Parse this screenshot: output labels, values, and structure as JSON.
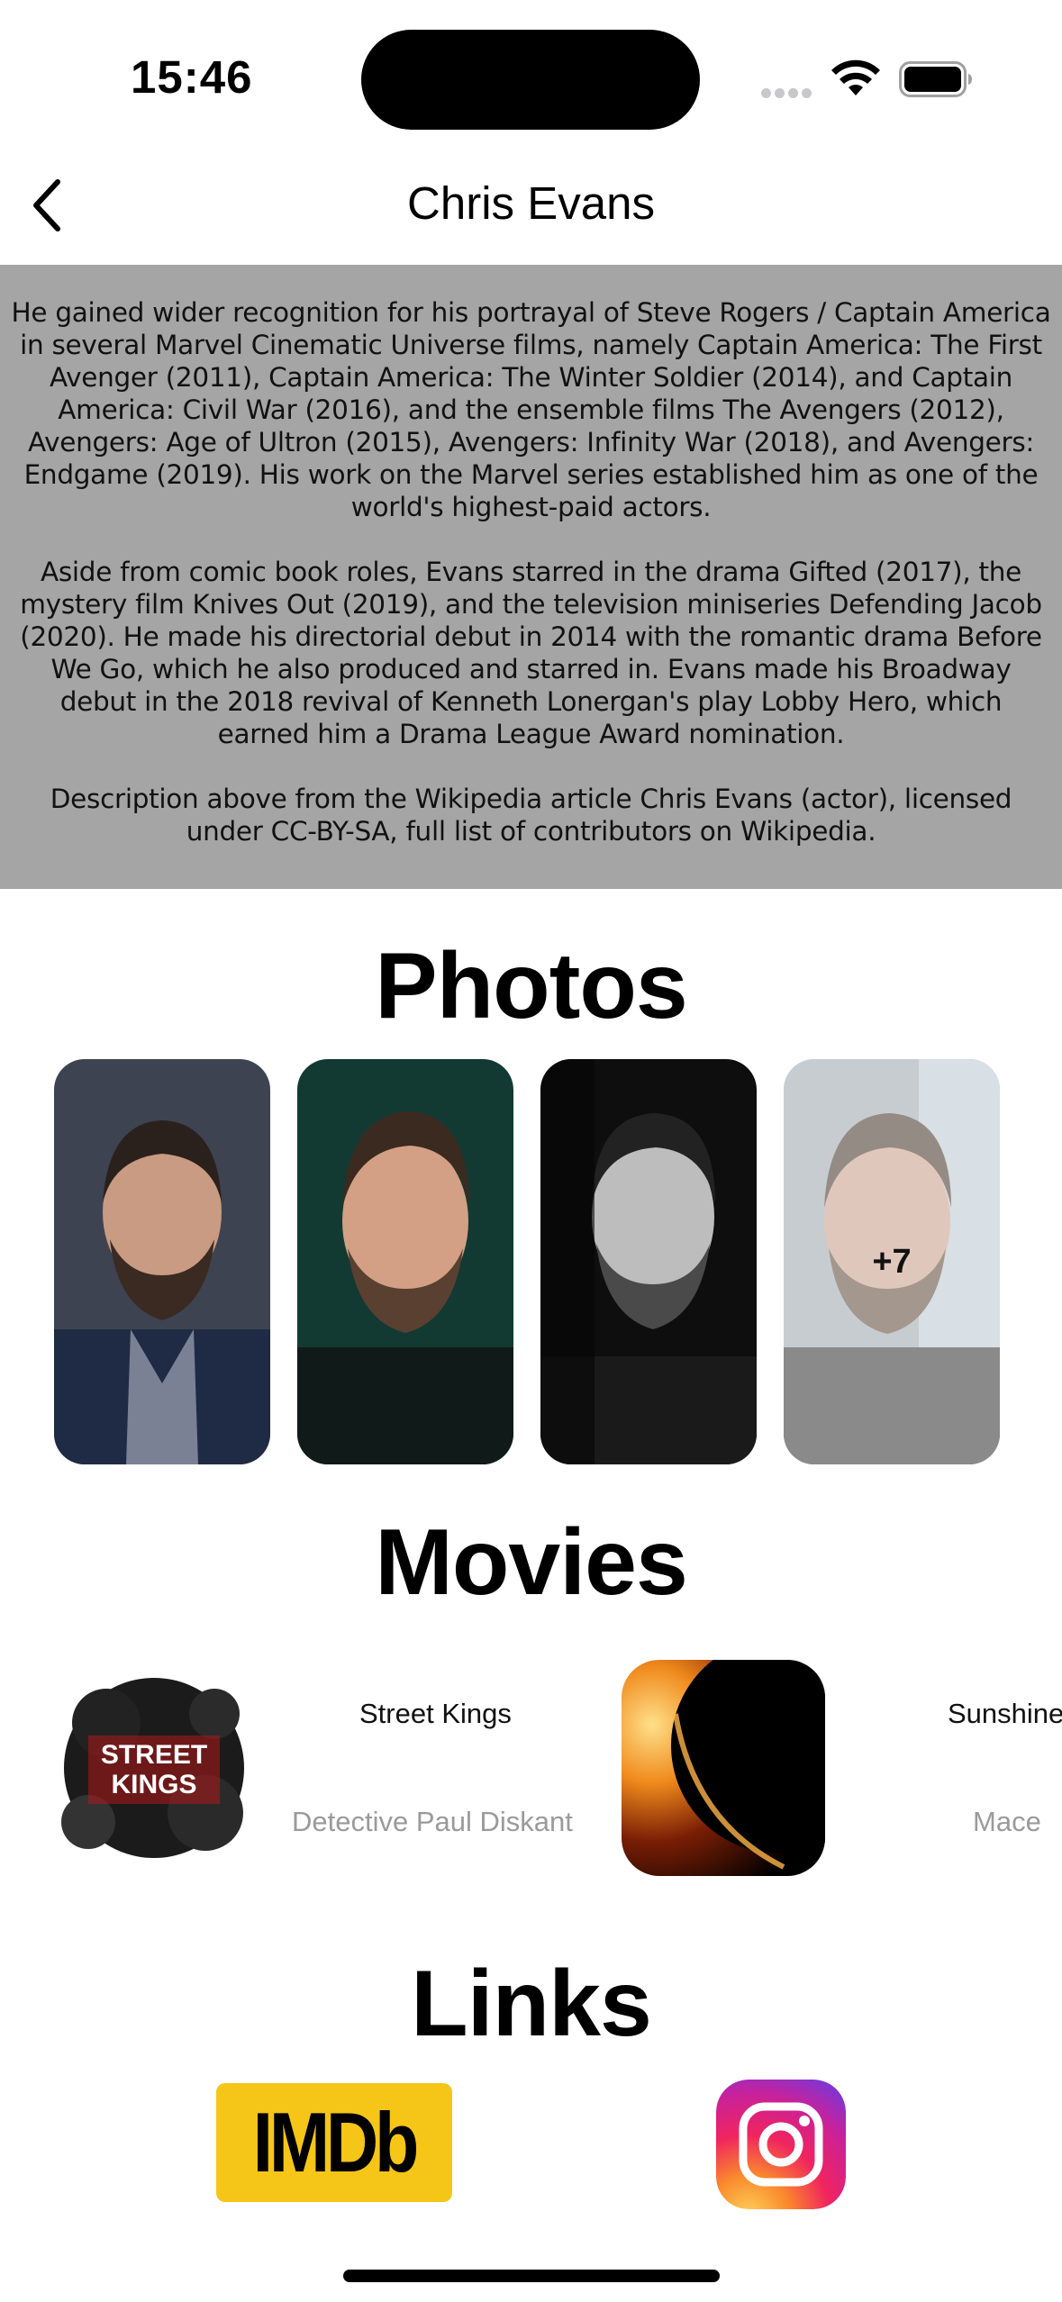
{
  "status_bar": {
    "time": "15:46"
  },
  "header": {
    "title": "Chris Evans",
    "back_icon": "chevron-left-icon"
  },
  "biography": {
    "paragraphs": [
      "He gained wider recognition for his portrayal of Steve Rogers / Captain America in several Marvel Cinematic Universe films, namely Captain America: The First Avenger (2011), Captain America: The Winter Soldier (2014), and Captain America: Civil War (2016), and the ensemble films The Avengers (2012), Avengers: Age of Ultron (2015), Avengers: Infinity War (2018), and Avengers: Endgame (2019). His work on the Marvel series established him as one of the world's highest-paid actors.",
      "Aside from comic book roles, Evans starred in the drama Gifted (2017), the mystery film Knives Out (2019), and the television miniseries Defending Jacob (2020). He made his directorial debut in 2014 with the romantic drama Before We Go, which he also produced and starred in. Evans made his Broadway debut in the 2018 revival of Kenneth Lonergan's play Lobby Hero, which earned him a Drama League Award nomination.",
      "Description above from the Wikipedia article Chris Evans (actor), licensed under CC-BY-SA, full list of contributors on Wikipedia."
    ],
    "background": "#a5a5a5"
  },
  "photos": {
    "title": "Photos",
    "more_label": "+7"
  },
  "movies": {
    "title": "Movies",
    "items": [
      {
        "title": "Street Kings",
        "role": "Detective Paul Diskant",
        "poster_text": "STREET KINGS"
      },
      {
        "title": "Sunshine",
        "role": "Mace"
      }
    ]
  },
  "links": {
    "title": "Links",
    "imdb_label": "IMDb",
    "imdb_color": "#f5c518",
    "instagram_icon": "instagram-icon"
  }
}
